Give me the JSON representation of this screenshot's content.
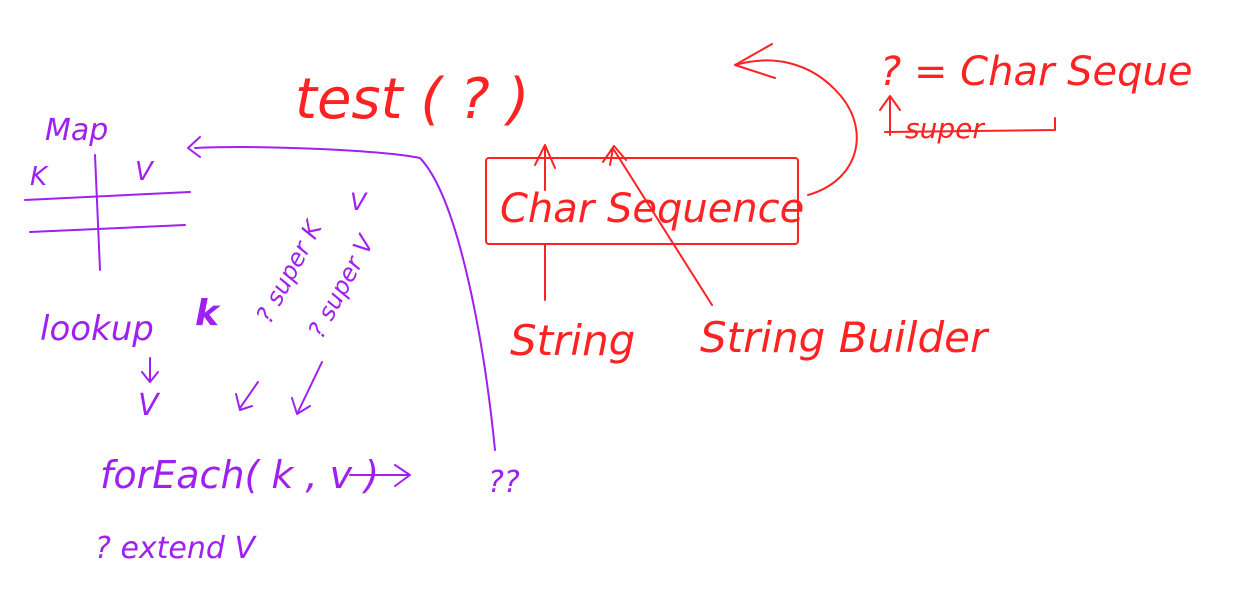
{
  "colors": {
    "red_ink": "#ff2222",
    "purple_ink": "#a020f0",
    "background": "#ffffff"
  },
  "red_notes": {
    "test_call": "test (  ?  )",
    "wildcard_rule": "? = Char Seque",
    "super_note": "super",
    "box_label": "Char Sequence",
    "string_label": "String",
    "stringbuilder_label": "String Builder"
  },
  "purple_notes": {
    "map_title": "Map",
    "map_key_header": "K",
    "map_value_header": "V",
    "lookup_label": "lookup",
    "lookup_key": "k",
    "super_k": "? super K",
    "super_v": "? super V",
    "super_v_right": "V",
    "result_v": "V",
    "foreach_call": "forEach( k , v )",
    "unknown": "??",
    "extends_note": "? extend V"
  }
}
